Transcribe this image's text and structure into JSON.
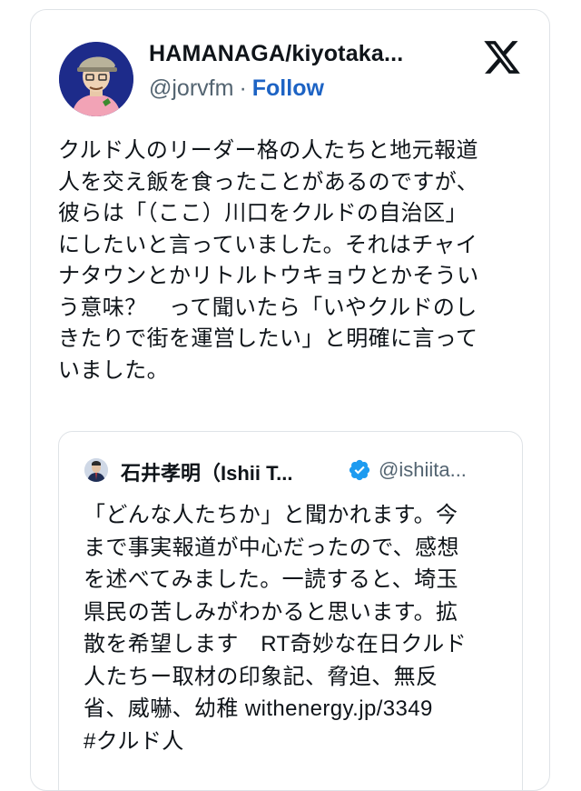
{
  "author": {
    "display_name": "HAMANAGA/kiyotaka...",
    "handle": "@jorvfm",
    "separator": "·",
    "follow_label": "Follow"
  },
  "tweet": {
    "text": "クルド人のリーダー格の人たちと地元報道\n人を交え飯を食ったことがあるのですが、\n彼らは「（ここ）川口をクルドの自治区」\nにしたいと言っていました。それはチャイ\nナタウンとかリトルトウキョウとかそうい\nう意味？　って聞いたら「いやクルドのし\nきたりで街を運営したい」と明確に言って\nいました。"
  },
  "quoted": {
    "display_name": "石井孝明（Ishii T...",
    "handle": "@ishiita...",
    "verified": true,
    "text": "「どんな人たちか」と聞かれます。今\nまで事実報道が中心だったので、感想\nを述べてみました。一読すると、埼玉\n県民の苦しみがわかると思います。拡\n散を希望します　RT奇妙な在日クルド\n人たちー取材の印象記、脅迫、無反\n省、威嚇、幼稚 withenergy.jp/3349\n#クルド人"
  },
  "icons": {
    "platform_logo": "x-logo-icon",
    "verified_badge": "verified-badge-icon"
  },
  "colors": {
    "follow_blue": "#1d63c4",
    "verified_blue": "#1d9bf0",
    "muted_gray": "#536471",
    "text": "#0f1419",
    "border": "#dfe3e7"
  }
}
